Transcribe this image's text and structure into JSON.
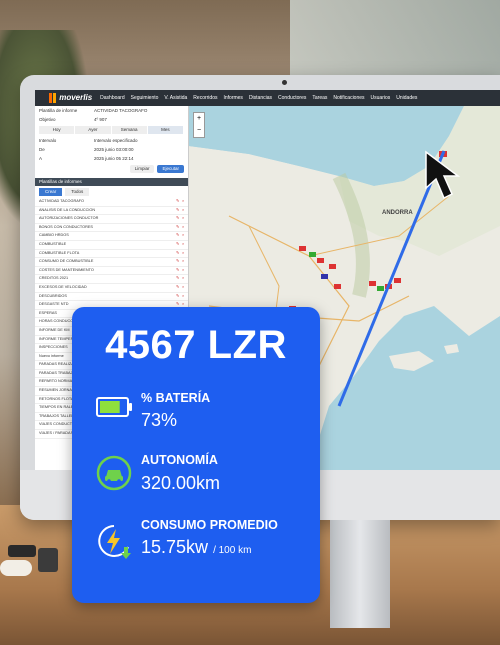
{
  "app": {
    "brand": "moverlis",
    "nav": [
      "Dashboard",
      "Seguimiento",
      "V. Asistida",
      "Recorridos",
      "Informes",
      "Distancias",
      "Conductores",
      "Tareas",
      "Notificaciones",
      "Usuarios",
      "Unidades"
    ]
  },
  "report_panel": {
    "fields": [
      {
        "label": "Plantilla de informe",
        "value": "ACTIVIDAD TACOGRAFO"
      },
      {
        "label": "Objetivo",
        "value": "4º 907"
      },
      {
        "label": "Intervalo",
        "value": "Intervalo especificado"
      },
      {
        "label": "De",
        "value": "2025 junio 03:00:00"
      },
      {
        "label": "A",
        "value": "2025 junio 05 22:14"
      }
    ],
    "tabs": [
      "Hoy",
      "Ayer",
      "Semana",
      "Mes"
    ],
    "buttons": {
      "clear": "Limpiar",
      "run": "Ejecutar"
    },
    "section_title": "Plantillas de informes",
    "subtabs": [
      "Crear",
      "Todos"
    ],
    "rows": [
      "ACTIVIDAD TACOGRAFO",
      "ANALISIS DE LA CONDUCCION",
      "AUTORIZACIONES CONDUCTOR",
      "BONOS CON CONDUCTORES",
      "CAMBIO HRDOS",
      "COMBUSTIBLE",
      "COMBUSTIBLE FLOTA",
      "CONSUMO DE COMBUSTIBLE",
      "COSTES DE MANTENIMIENTO",
      "CREDITOS 2021",
      "EXCESOS DE VELOCIDAD",
      "DESCUBRIDOS",
      "DESGASTE NTD",
      "ESPERAS",
      "HORAS CONDUCCION",
      "INFORME DE KM",
      "INFORME TEMPERATURA",
      "INSPECCIONES",
      "Nuevo informe",
      "PARADAS REALIZADAS",
      "PARADAS TRABAJADOR",
      "REPARTO NORMATIVO",
      "RESUMEN JORNADA",
      "RETORNOS FLOTA",
      "TIEMPOS EN RALENTI",
      "TRABAJOS TALLER",
      "VIAJES CONDUCTOR",
      "VIAJES / PARADAS"
    ]
  },
  "map": {
    "labels": [
      "ANDORRA"
    ]
  },
  "vehicle_card": {
    "plate": "4567 LZR",
    "battery": {
      "label": "% BATERÍA",
      "value": "73%",
      "level": 0.73
    },
    "range": {
      "label": "AUTONOMÍA",
      "value": "320.00km"
    },
    "consumption": {
      "label": "CONSUMO PROMEDIO",
      "value": "15.75kw",
      "unit": "/ 100 km"
    }
  },
  "colors": {
    "accent": "#1e5ef0",
    "battery_fill": "#8fe03c",
    "icon_green": "#6fd14b",
    "icon_yellow": "#f7c52a",
    "route": "#2f6be8"
  }
}
